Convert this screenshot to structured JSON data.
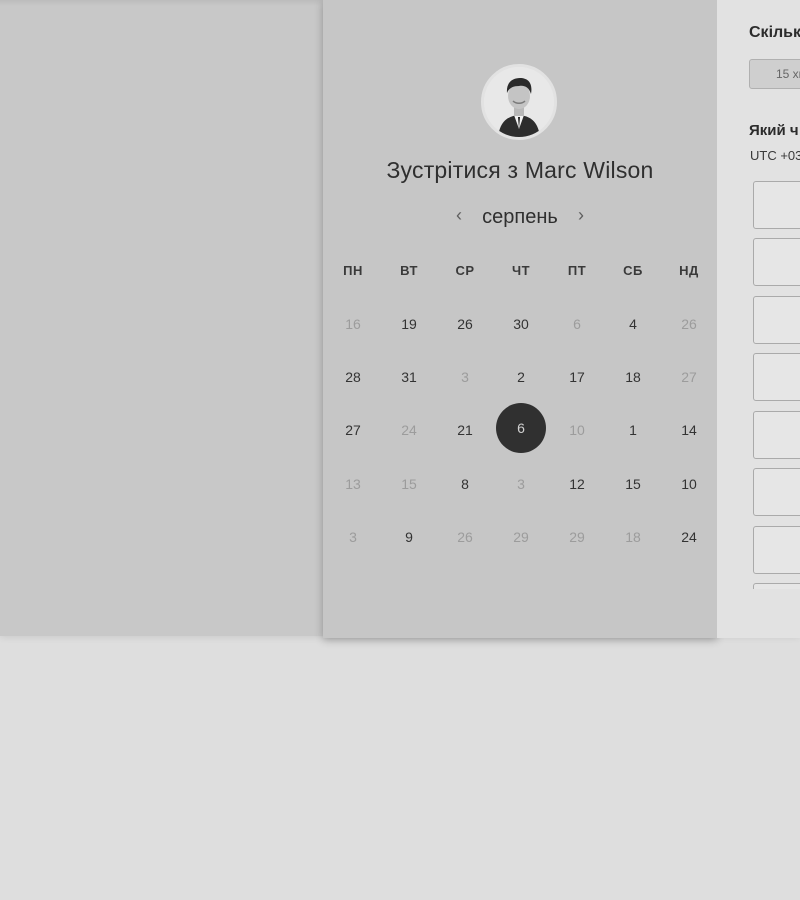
{
  "booking": {
    "title_prefix": "Зустрітися з",
    "host_name": "Marc Wilson",
    "month": "серпень",
    "weekdays": [
      "ПН",
      "ВТ",
      "СР",
      "ЧТ",
      "ПТ",
      "СБ",
      "НД"
    ],
    "days": [
      {
        "label": "16",
        "muted": true
      },
      {
        "label": "19",
        "muted": false
      },
      {
        "label": "26",
        "muted": false
      },
      {
        "label": "30",
        "muted": false
      },
      {
        "label": "6",
        "muted": true
      },
      {
        "label": "4",
        "muted": false
      },
      {
        "label": "26",
        "muted": true
      },
      {
        "label": "28",
        "muted": false
      },
      {
        "label": "31",
        "muted": false
      },
      {
        "label": "3",
        "muted": true
      },
      {
        "label": "2",
        "muted": false
      },
      {
        "label": "17",
        "muted": false
      },
      {
        "label": "18",
        "muted": false
      },
      {
        "label": "27",
        "muted": true
      },
      {
        "label": "27",
        "muted": false
      },
      {
        "label": "24",
        "muted": true
      },
      {
        "label": "21",
        "muted": false
      },
      {
        "label": "6",
        "muted": false,
        "selected": true
      },
      {
        "label": "10",
        "muted": true
      },
      {
        "label": "1",
        "muted": false
      },
      {
        "label": "14",
        "muted": false
      },
      {
        "label": "13",
        "muted": true
      },
      {
        "label": "15",
        "muted": true
      },
      {
        "label": "8",
        "muted": false
      },
      {
        "label": "3",
        "muted": true
      },
      {
        "label": "12",
        "muted": false
      },
      {
        "label": "15",
        "muted": false
      },
      {
        "label": "10",
        "muted": false
      },
      {
        "label": "3",
        "muted": true
      },
      {
        "label": "9",
        "muted": false
      },
      {
        "label": "26",
        "muted": true
      },
      {
        "label": "29",
        "muted": true
      },
      {
        "label": "29",
        "muted": true
      },
      {
        "label": "18",
        "muted": true
      },
      {
        "label": "24",
        "muted": false
      }
    ]
  },
  "side": {
    "duration_label": "Скільк",
    "duration_value": "15 хв",
    "time_label": "Який ч",
    "timezone": "UTC +03"
  },
  "icons": {
    "prev": "chevron-left-icon",
    "next": "chevron-right-icon"
  },
  "colors": {
    "selected_day_bg": "#303030",
    "panel_bg": "#c6c6c6"
  }
}
